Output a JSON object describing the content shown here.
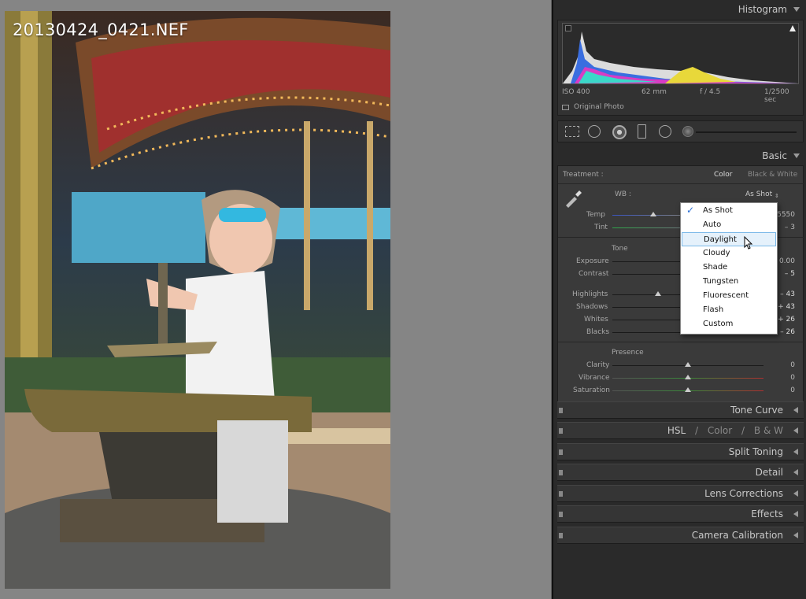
{
  "photo": {
    "filename": "20130424_0421.NEF"
  },
  "histogram": {
    "title": "Histogram",
    "iso": "ISO 400",
    "focal": "62 mm",
    "aperture": "f / 4.5",
    "shutter": "1/2500 sec",
    "original_photo": "Original Photo"
  },
  "basic": {
    "title": "Basic",
    "treatment_label": "Treatment :",
    "treatment_color": "Color",
    "treatment_bw": "Black & White",
    "wb_label": "WB :",
    "wb_value": "As Shot",
    "temp_label": "Temp",
    "temp_value": "5550",
    "tint_label": "Tint",
    "tint_value": "– 3",
    "tone_label": "Tone",
    "exposure_label": "Exposure",
    "exposure_value": "0.00",
    "contrast_label": "Contrast",
    "contrast_value": "– 5",
    "highlights_label": "Highlights",
    "highlights_value": "– 43",
    "shadows_label": "Shadows",
    "shadows_value": "+ 43",
    "whites_label": "Whites",
    "whites_value": "+ 26",
    "blacks_label": "Blacks",
    "blacks_value": "– 26",
    "presence_label": "Presence",
    "clarity_label": "Clarity",
    "clarity_value": "0",
    "vibrance_label": "Vibrance",
    "vibrance_value": "0",
    "saturation_label": "Saturation",
    "saturation_value": "0"
  },
  "wb_menu": {
    "options": [
      "As Shot",
      "Auto",
      "Daylight",
      "Cloudy",
      "Shade",
      "Tungsten",
      "Fluorescent",
      "Flash",
      "Custom"
    ],
    "checked": "As Shot",
    "highlighted": "Daylight"
  },
  "panels": {
    "tone_curve": "Tone Curve",
    "hsl": "HSL",
    "sep": "/",
    "color": "Color",
    "bw": "B & W",
    "split_toning": "Split Toning",
    "detail": "Detail",
    "lens_corrections": "Lens Corrections",
    "effects": "Effects",
    "camera_calibration": "Camera Calibration"
  },
  "colors": {
    "accent": "#3399ff",
    "panel": "#3a3a3a"
  }
}
